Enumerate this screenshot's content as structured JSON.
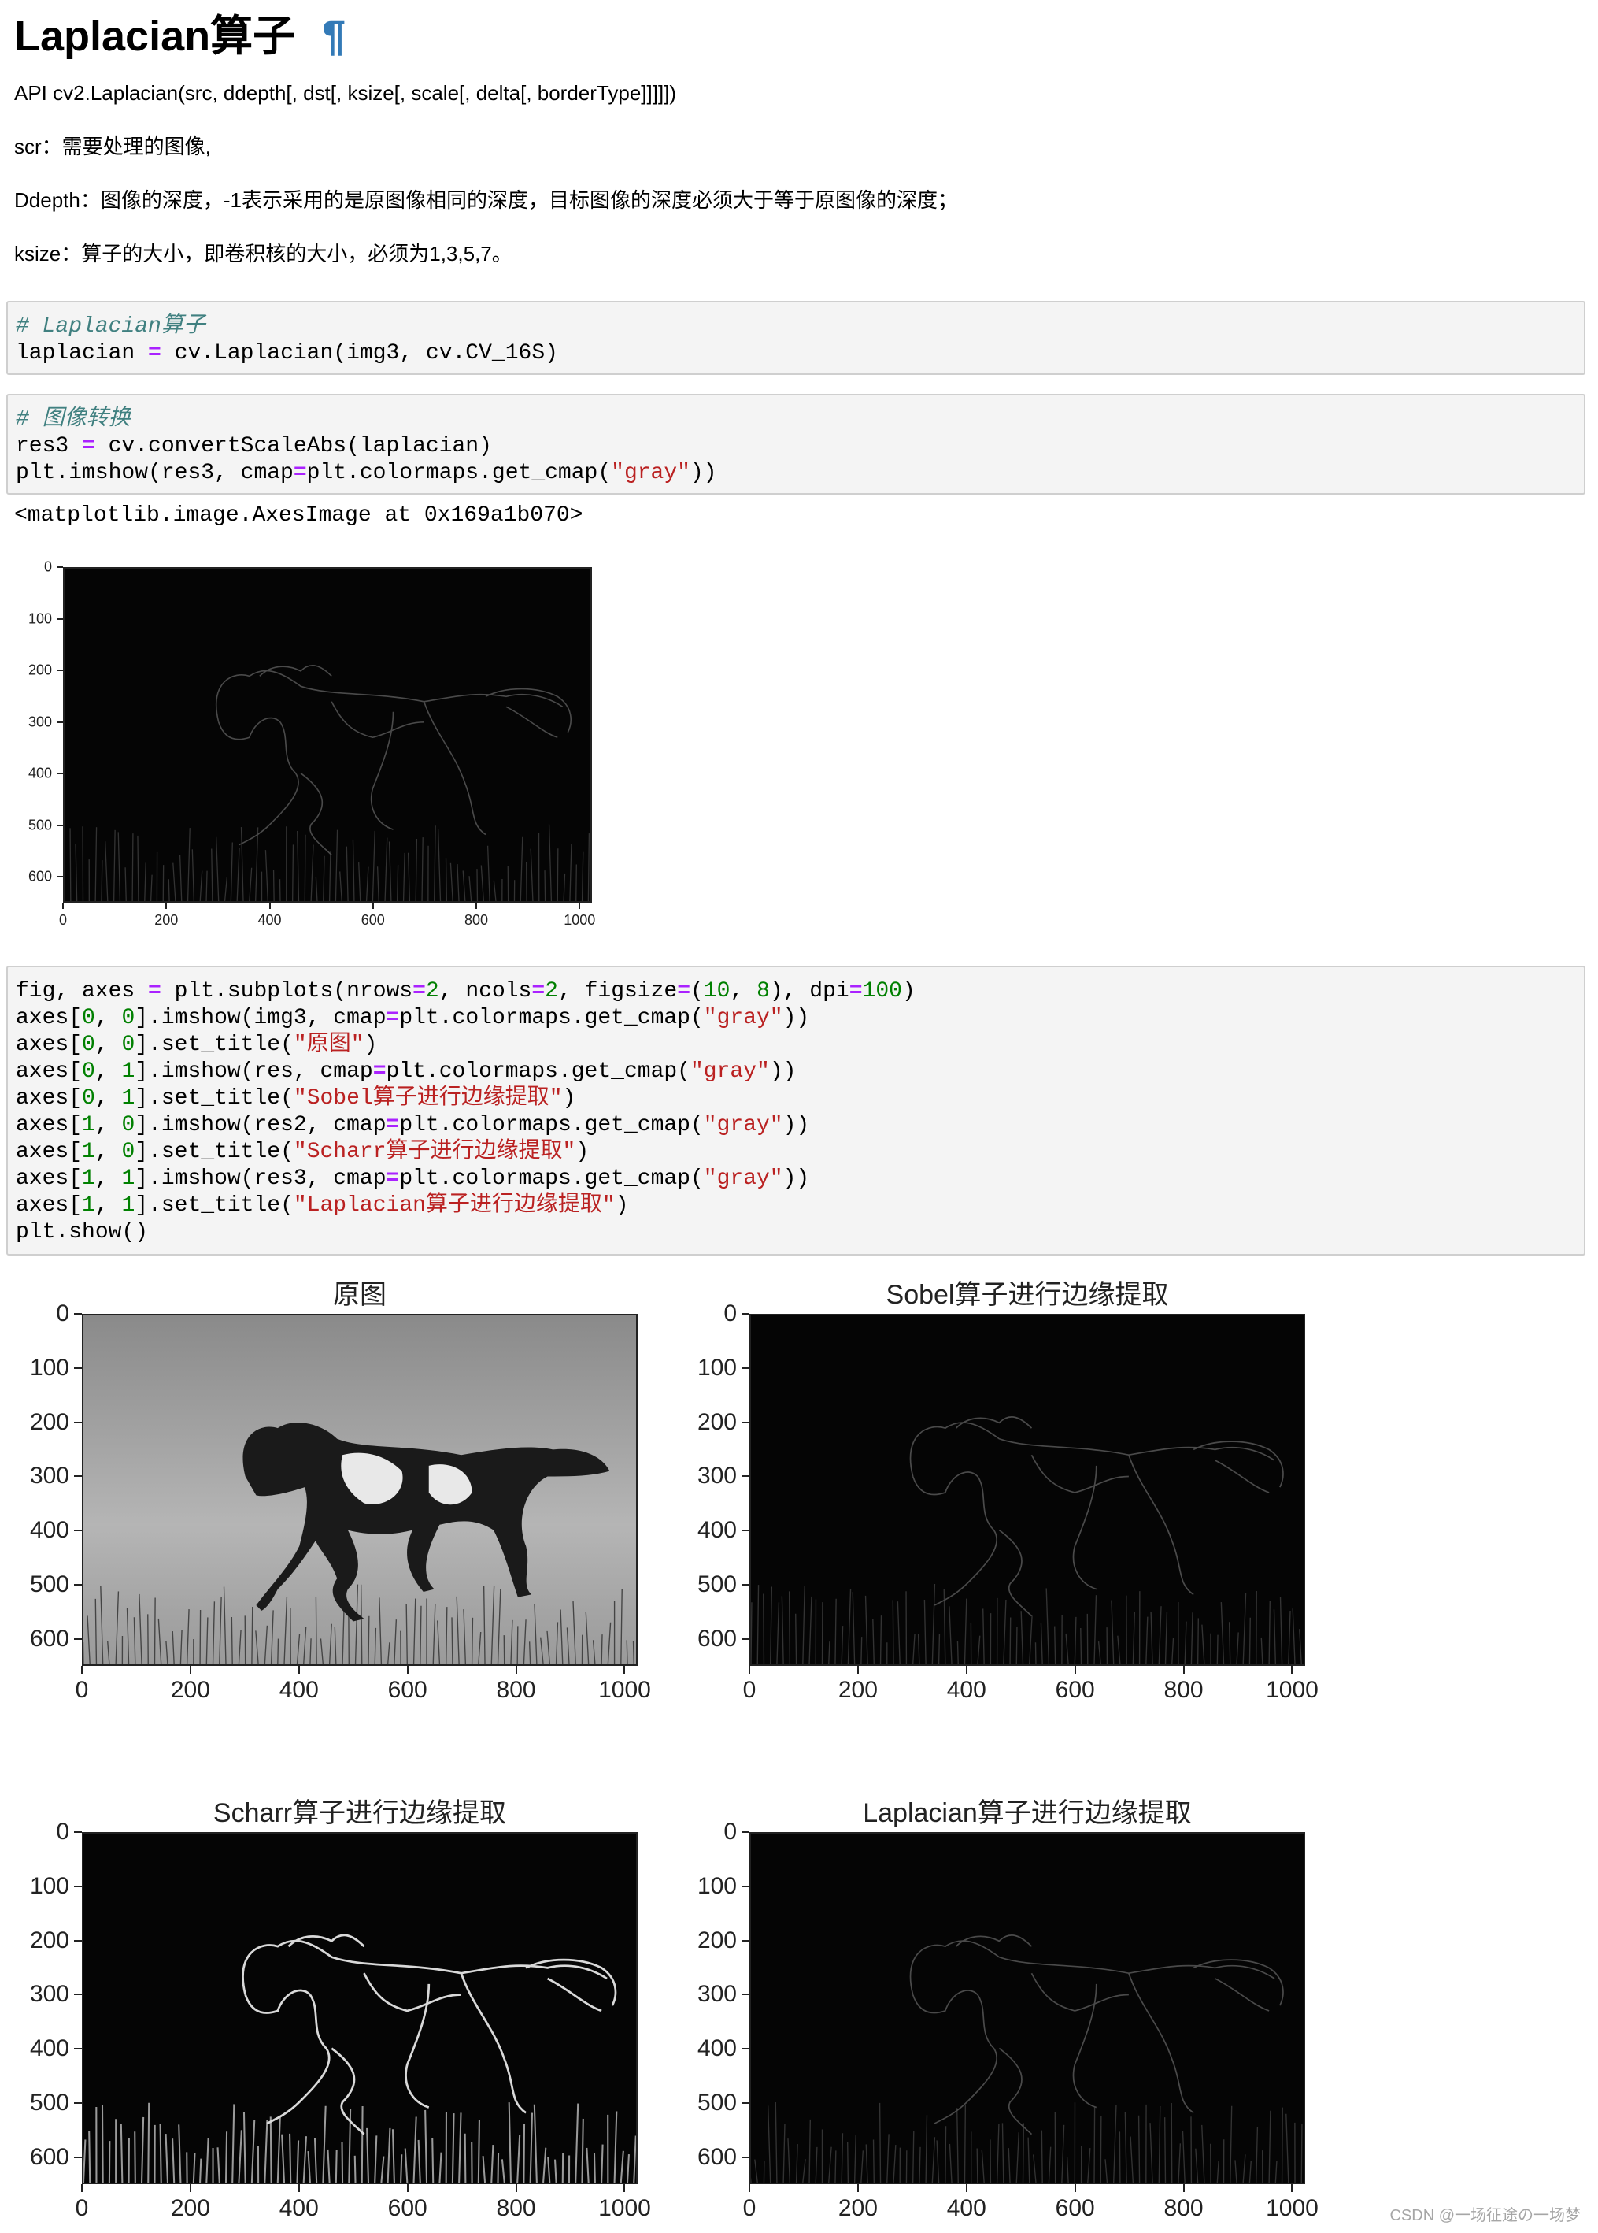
{
  "heading": {
    "title": "Laplacian算子",
    "pilcrow": "¶"
  },
  "desc": [
    "API cv2.Laplacian(src, ddepth[, dst[, ksize[, scale[, delta[, borderType]]]]])",
    "scr：需要处理的图像,",
    "Ddepth：图像的深度，-1表示采用的是原图像相同的深度，目标图像的深度必须大于等于原图像的深度；",
    "ksize：算子的大小，即卷积核的大小，必须为1,3,5,7。"
  ],
  "cell1": {
    "comment": "# Laplacian算子",
    "l2a": "laplacian ",
    "l2op": "=",
    "l2b": " cv.Laplacian(img3, cv.CV_16S)"
  },
  "cell2": {
    "comment": "# 图像转换",
    "l2a": "res3 ",
    "l2op": "=",
    "l2b": " cv.convertScaleAbs(laplacian)",
    "l3a": "plt.imshow(res3, cmap",
    "l3op": "=",
    "l3b": "plt.colormaps.get_cmap(",
    "l3s": "\"gray\"",
    "l3c": "))"
  },
  "output_text": "<matplotlib.image.AxesImage at 0x169a1b070>",
  "cell3": {
    "l1": [
      "fig, axes ",
      "=",
      " plt.subplots(nrows",
      "=",
      "2",
      ", ncols",
      "=",
      "2",
      ", figsize",
      "=",
      "(",
      "10",
      ", ",
      "8",
      "), dpi",
      "=",
      "100",
      ")"
    ],
    "l2": [
      "axes[",
      "0",
      ", ",
      "0",
      "].imshow(img3, cmap",
      "=",
      "plt.colormaps.get_cmap(",
      "\"gray\"",
      "))"
    ],
    "l3": [
      "axes[",
      "0",
      ", ",
      "0",
      "].set_title(",
      "\"原图\"",
      ")"
    ],
    "l4": [
      "axes[",
      "0",
      ", ",
      "1",
      "].imshow(res, cmap",
      "=",
      "plt.colormaps.get_cmap(",
      "\"gray\"",
      "))"
    ],
    "l5": [
      "axes[",
      "0",
      ", ",
      "1",
      "].set_title(",
      "\"Sobel算子进行边缘提取\"",
      ")"
    ],
    "l6": [
      "axes[",
      "1",
      ", ",
      "0",
      "].imshow(res2, cmap",
      "=",
      "plt.colormaps.get_cmap(",
      "\"gray\"",
      "))"
    ],
    "l7": [
      "axes[",
      "1",
      ", ",
      "0",
      "].set_title(",
      "\"Scharr算子进行边缘提取\"",
      ")"
    ],
    "l8": [
      "axes[",
      "1",
      ", ",
      "1",
      "].imshow(res3, cmap",
      "=",
      "plt.colormaps.get_cmap(",
      "\"gray\"",
      "))"
    ],
    "l9": [
      "axes[",
      "1",
      ", ",
      "1",
      "].set_title(",
      "\"Laplacian算子进行边缘提取\"",
      ")"
    ],
    "l10": "plt.show()"
  },
  "chart_data": [
    {
      "type": "image",
      "title": "",
      "xticks": [
        0,
        200,
        400,
        600,
        800,
        1000
      ],
      "yticks": [
        0,
        100,
        200,
        300,
        400,
        500,
        600
      ],
      "xlim": [
        0,
        1024
      ],
      "ylim": [
        0,
        650
      ],
      "cmap": "gray"
    },
    {
      "type": "image",
      "title": "原图",
      "xticks": [
        0,
        200,
        400,
        600,
        800,
        1000
      ],
      "yticks": [
        0,
        100,
        200,
        300,
        400,
        500,
        600
      ],
      "xlim": [
        0,
        1024
      ],
      "ylim": [
        0,
        650
      ],
      "cmap": "gray"
    },
    {
      "type": "image",
      "title": "Sobel算子进行边缘提取",
      "xticks": [
        0,
        200,
        400,
        600,
        800,
        1000
      ],
      "yticks": [
        0,
        100,
        200,
        300,
        400,
        500,
        600
      ],
      "xlim": [
        0,
        1024
      ],
      "ylim": [
        0,
        650
      ],
      "cmap": "gray"
    },
    {
      "type": "image",
      "title": "Scharr算子进行边缘提取",
      "xticks": [
        0,
        200,
        400,
        600,
        800,
        1000
      ],
      "yticks": [
        0,
        100,
        200,
        300,
        400,
        500,
        600
      ],
      "xlim": [
        0,
        1024
      ],
      "ylim": [
        0,
        650
      ],
      "cmap": "gray"
    },
    {
      "type": "image",
      "title": "Laplacian算子进行边缘提取",
      "xticks": [
        0,
        200,
        400,
        600,
        800,
        1000
      ],
      "yticks": [
        0,
        100,
        200,
        300,
        400,
        500,
        600
      ],
      "xlim": [
        0,
        1024
      ],
      "ylim": [
        0,
        650
      ],
      "cmap": "gray"
    }
  ],
  "watermark": "CSDN @一场征途の一场梦"
}
